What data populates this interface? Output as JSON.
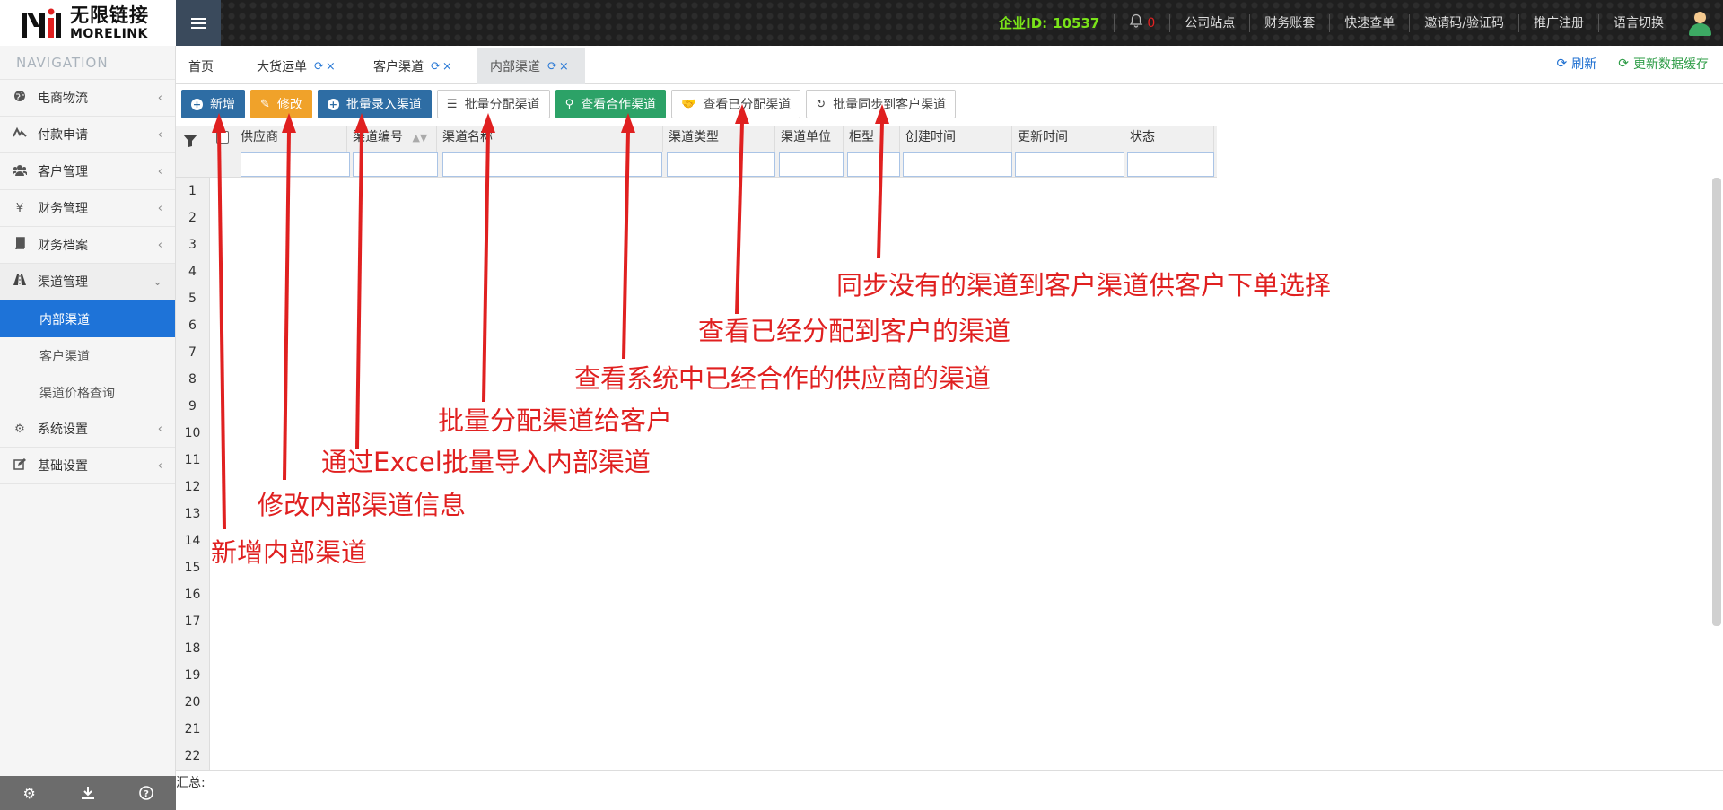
{
  "app": {
    "logo_cn": "无限链接",
    "logo_en": "MORELINK",
    "company_label": "企业ID:",
    "company_id": "10537",
    "notifications": "0",
    "top_links": [
      "公司站点",
      "财务账套",
      "快速查单",
      "邀请码/验证码",
      "推广注册",
      "语言切换"
    ]
  },
  "sidebar": {
    "title": "NAVIGATION",
    "items": [
      {
        "label": "电商物流",
        "icon": "globe-icon"
      },
      {
        "label": "付款申请",
        "icon": "payment-icon"
      },
      {
        "label": "客户管理",
        "icon": "users-icon"
      },
      {
        "label": "财务管理",
        "icon": "yen-icon"
      },
      {
        "label": "财务档案",
        "icon": "book-icon"
      },
      {
        "label": "渠道管理",
        "icon": "road-icon"
      },
      {
        "label": "系统设置",
        "icon": "gear-icon"
      },
      {
        "label": "基础设置",
        "icon": "edit-icon"
      }
    ],
    "subitems": [
      "内部渠道",
      "客户渠道",
      "渠道价格查询"
    ]
  },
  "tabs": {
    "items": [
      "首页",
      "大货运单",
      "客户渠道",
      "内部渠道"
    ],
    "refresh": "刷新",
    "update_cache": "更新数据缓存"
  },
  "toolbar": {
    "buttons": [
      "新增",
      "修改",
      "批量录入渠道",
      "批量分配渠道",
      "查看合作渠道",
      "查看已分配渠道",
      "批量同步到客户渠道"
    ]
  },
  "grid": {
    "columns": [
      "供应商",
      "渠道编号",
      "渠道名称",
      "渠道类型",
      "渠道单位",
      "柜型",
      "创建时间",
      "更新时间",
      "状态"
    ],
    "rows": [
      "1",
      "2",
      "3",
      "4",
      "5",
      "6",
      "7",
      "8",
      "9",
      "10",
      "11",
      "12",
      "13",
      "14",
      "15",
      "16",
      "17",
      "18",
      "19",
      "20",
      "21",
      "22"
    ],
    "footer": "汇总:"
  },
  "annotations": [
    "同步没有的渠道到客户渠道供客户下单选择",
    "查看已经分配到客户的渠道",
    "查看系统中已经合作的供应商的渠道",
    "批量分配渠道给客户",
    "通过Excel批量导入内部渠道",
    "修改内部渠道信息",
    "新增内部渠道"
  ],
  "colors": {
    "annotation": "#e02020",
    "active_nav": "#1e73d8",
    "company_id": "#7ae319"
  }
}
